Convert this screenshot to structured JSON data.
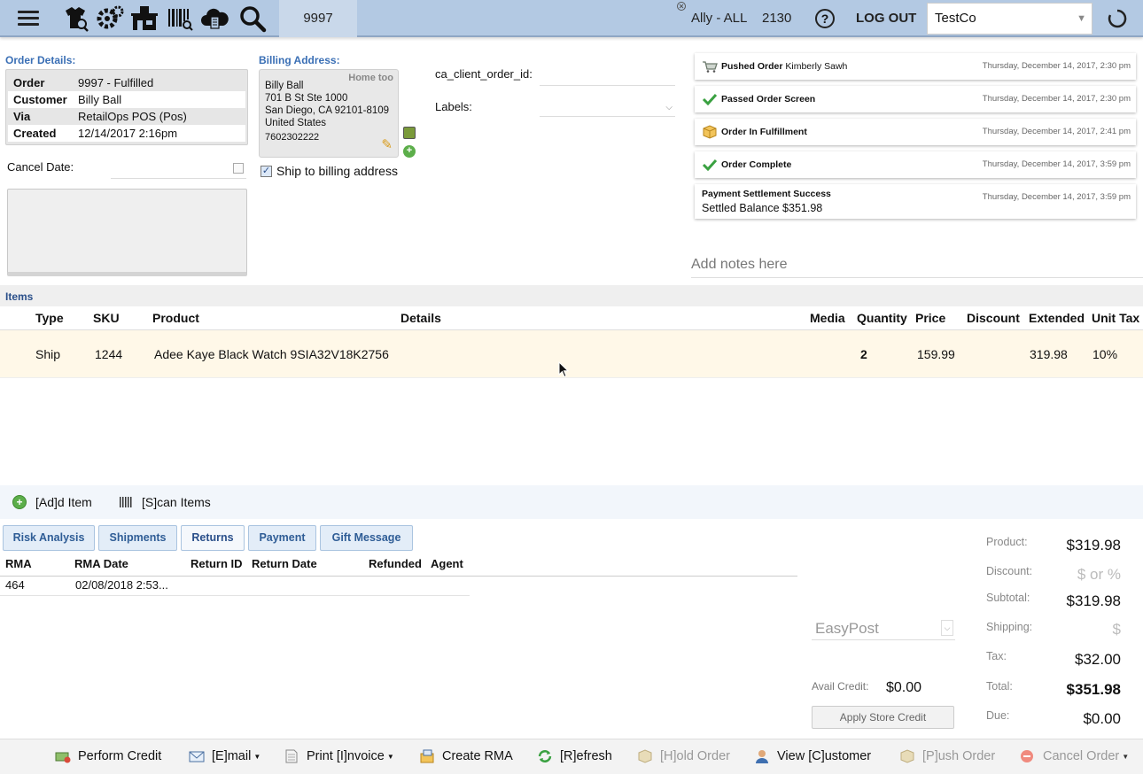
{
  "topbar": {
    "order_search": "9997",
    "user": "Ally - ALL",
    "station": "2130",
    "logout_label": "LOG OUT",
    "company": "TestCo",
    "help_glyph": "?"
  },
  "order_details": {
    "heading": "Order Details:",
    "rows": [
      {
        "key": "Order",
        "value": "9997 - Fulfilled"
      },
      {
        "key": "Customer",
        "value": "Billy Ball"
      },
      {
        "key": "Via",
        "value": "RetailOps POS (Pos)"
      },
      {
        "key": "Created",
        "value": "12/14/2017 2:16pm"
      }
    ],
    "cancel_date_label": "Cancel Date:"
  },
  "billing": {
    "heading": "Billing Address:",
    "tag": "Home too",
    "name": "Billy Ball",
    "line1": "701 B St Ste 1000",
    "line2": "San Diego, CA 92101-8109",
    "country": "United States",
    "phone": "7602302222",
    "ship_to_billing_label": "Ship to billing address"
  },
  "fields": {
    "client_order_id_label": "ca_client_order_id:",
    "labels_label": "Labels:"
  },
  "timeline": [
    {
      "title": "Pushed Order",
      "detail": "Kimberly Sawh",
      "date": "Thursday, December 14, 2017, 2:30 pm",
      "icon": "cart-icon"
    },
    {
      "title": "Passed Order Screen",
      "detail": "",
      "date": "Thursday, December 14, 2017, 2:30 pm",
      "icon": "check-icon"
    },
    {
      "title": "Order In Fulfillment",
      "detail": "",
      "date": "Thursday, December 14, 2017, 2:41 pm",
      "icon": "box-icon"
    },
    {
      "title": "Order Complete",
      "detail": "",
      "date": "Thursday, December 14, 2017, 3:59 pm",
      "icon": "check-icon"
    },
    {
      "title": "Payment Settlement Success",
      "detail": "Settled Balance $351.98",
      "date": "Thursday, December 14, 2017, 3:59 pm",
      "icon": ""
    }
  ],
  "notes_placeholder": "Add notes here",
  "items": {
    "heading": "Items",
    "columns": [
      "Type",
      "SKU",
      "Product",
      "Details",
      "Media",
      "Quantity",
      "Price",
      "Discount",
      "Extended",
      "Unit Tax"
    ],
    "rows": [
      {
        "type": "Ship",
        "sku": "1244",
        "product": "Adee Kaye Black Watch 9SIA32V18K2756",
        "details": "",
        "media": "",
        "quantity": "2",
        "price": "159.99",
        "discount": "",
        "extended": "319.98",
        "unit_tax": "10%"
      }
    ],
    "add_item_label": "[Ad]d Item",
    "scan_items_label": "[S]can Items"
  },
  "tabs": [
    {
      "label": "Risk Analysis"
    },
    {
      "label": "Shipments"
    },
    {
      "label": "Returns"
    },
    {
      "label": "Payment"
    },
    {
      "label": "Gift Message"
    }
  ],
  "returns": {
    "columns": [
      "RMA",
      "RMA Date",
      "Return ID",
      "Return Date",
      "Refunded",
      "Agent"
    ],
    "rows": [
      {
        "rma": "464",
        "rma_date": "02/08/2018 2:53...",
        "return_id": "",
        "return_date": "",
        "refunded": "",
        "agent": ""
      }
    ]
  },
  "shipping": {
    "carrier": "EasyPost",
    "avail_credit_label": "Avail Credit:",
    "avail_credit": "$0.00",
    "apply_credit_label": "Apply Store Credit"
  },
  "totals": [
    {
      "label": "Product:",
      "value": "$319.98",
      "style": ""
    },
    {
      "label": "Discount:",
      "value": "$ or %",
      "style": "ph"
    },
    {
      "label": "Subtotal:",
      "value": "$319.98",
      "style": ""
    },
    {
      "label": "Shipping:",
      "value": "$",
      "style": "ph"
    },
    {
      "label": "Tax:",
      "value": "$32.00",
      "style": ""
    },
    {
      "label": "Total:",
      "value": "$351.98",
      "style": "bold"
    },
    {
      "label": "Due:",
      "value": "$0.00",
      "style": ""
    }
  ],
  "actions": {
    "perform_credit": "Perform Credit",
    "email": "[E]mail",
    "print_invoice": "Print [I]nvoice",
    "create_rma": "Create RMA",
    "refresh": "[R]efresh",
    "hold_order": "[H]old Order",
    "view_customer": "View [C]ustomer",
    "push_order": "[P]ush Order",
    "cancel_order": "Cancel Order"
  },
  "colors": {
    "topbar": "#b3c9e3",
    "accent": "#3a6fb5",
    "item_row": "#fff8e8"
  }
}
